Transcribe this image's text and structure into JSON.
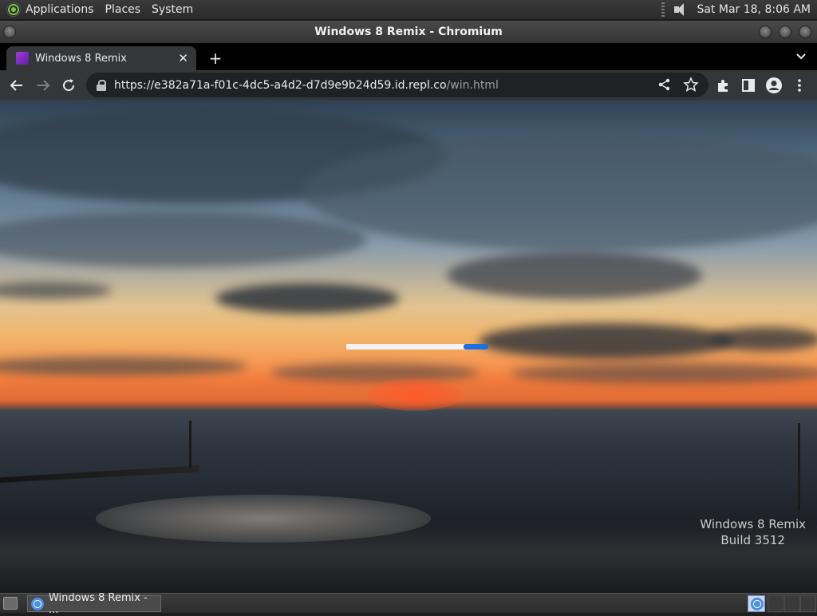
{
  "top_panel": {
    "menus": [
      "Applications",
      "Places",
      "System"
    ],
    "clock": "Sat Mar 18,  8:06 AM"
  },
  "window": {
    "title": "Windows 8 Remix - Chromium"
  },
  "browser": {
    "tab": {
      "title": "Windows 8 Remix",
      "close_label": "✕"
    },
    "new_tab_label": "+",
    "url_host": "https://e382a71a-f01c-4dc5-a4d2-d7d9e9b24d59.id.repl.co",
    "url_path": "/win.html"
  },
  "page": {
    "loader_progress": 0.3,
    "watermark_line1": "Windows 8 Remix",
    "watermark_line2": "Build 3512"
  },
  "taskbar": {
    "task_label": "Windows 8 Remix - ..."
  }
}
